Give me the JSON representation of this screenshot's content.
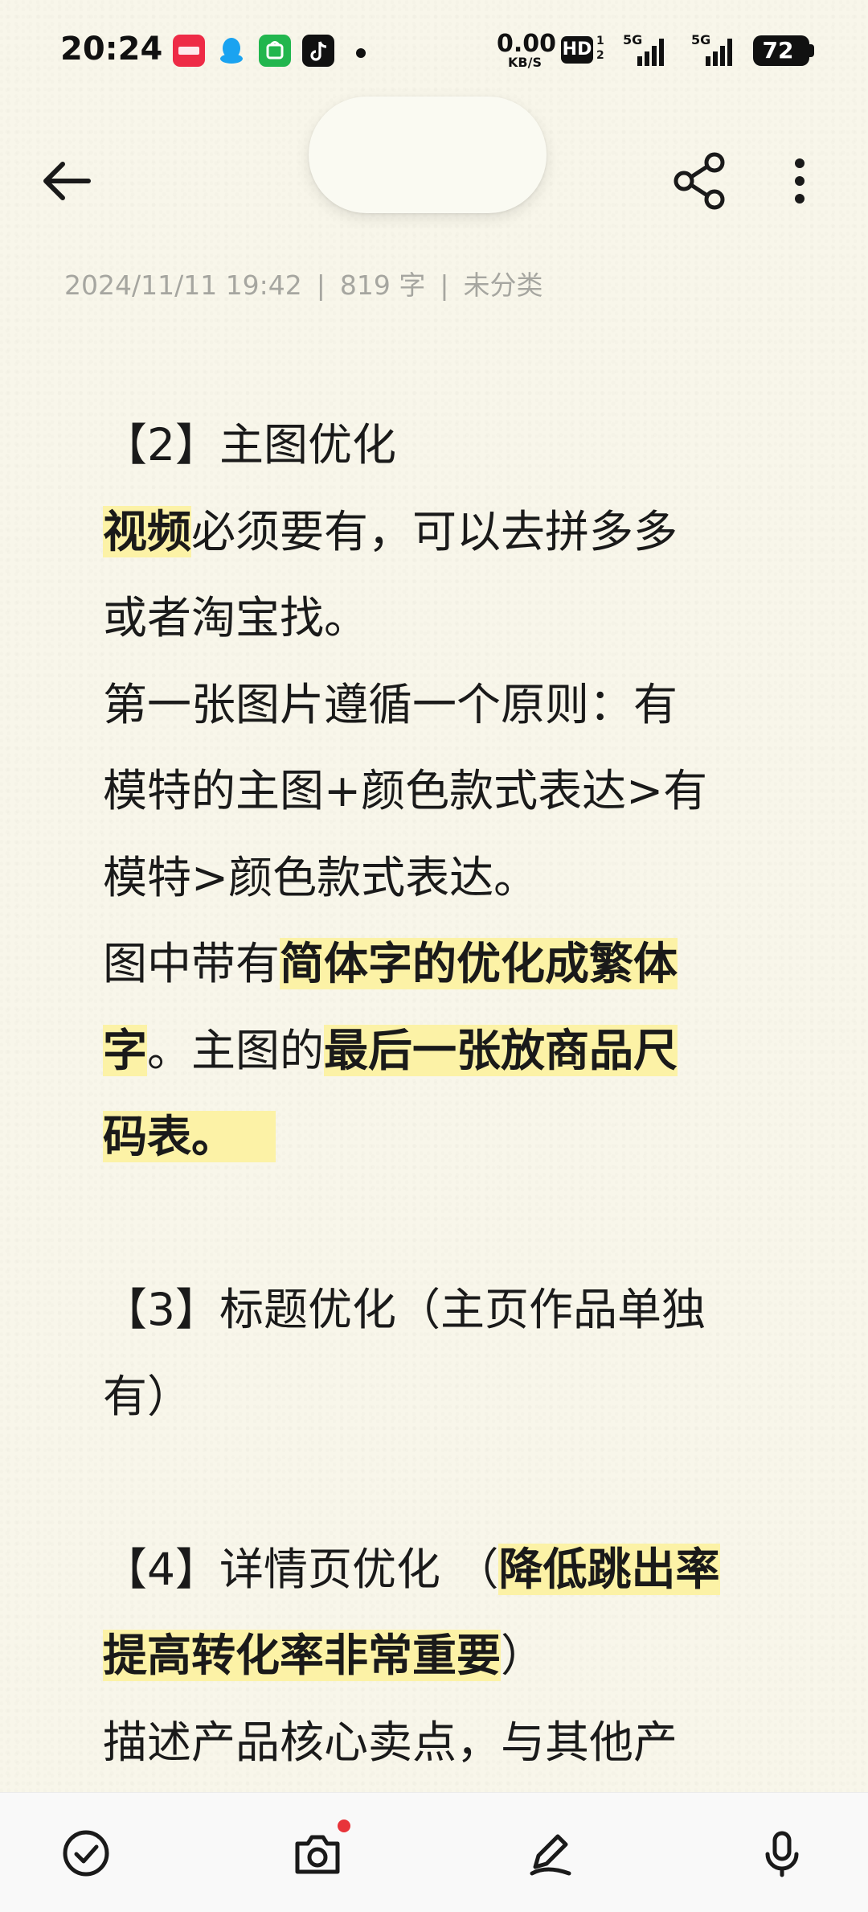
{
  "status_bar": {
    "time": "20:24",
    "net_speed_value": "0.00",
    "net_speed_unit": "KB/S",
    "hd": "HD",
    "hd_sub_top": "1",
    "hd_sub_bottom": "2",
    "sim1_label": "5G",
    "sim2_label": "5G",
    "battery": "72",
    "app_icons": [
      "xiaohongshu-icon",
      "qq-icon",
      "app-store-icon",
      "tiktok-icon"
    ]
  },
  "toolbar": {
    "back_icon": "arrow-left-icon",
    "share_icon": "share-icon",
    "more_icon": "more-vertical-icon"
  },
  "meta": {
    "datetime": "2024/11/11 19:42",
    "word_count": "819 字",
    "category": "未分类"
  },
  "note": {
    "s2_heading": "【2】主图优化",
    "s2_p1_hl": "视频",
    "s2_p1_rest": "必须要有，可以去拼多多",
    "s2_p1_line2": "或者淘宝找。",
    "s2_p2_line1": "第一张图片遵循一个原则：有",
    "s2_p2_line2": "模特的主图+颜色款式表达>有",
    "s2_p2_line3": "模特>颜色款式表达。",
    "s2_p3_a": "图中带有",
    "s2_p3_hl1": "简体字的优化成繁体",
    "s2_p3_hl1b": "字",
    "s2_p3_b": "。主图的",
    "s2_p3_hl2": "最后一张放商品尺",
    "s2_p3_hl2b": "码表。",
    "s3_heading_l1": "【3】标题优化（主页作品单独",
    "s3_heading_l2": "有）",
    "s4_heading_a": "【4】详情页优化 （",
    "s4_heading_hl1": "降低跳出率",
    "s4_heading_hl2": "提高转化率非常重要",
    "s4_heading_b": "）",
    "s4_p1_line1": "描述产品核心卖点，与其他产"
  },
  "bottom_bar": {
    "items": [
      "checklist-icon",
      "camera-icon",
      "pen-icon",
      "microphone-icon"
    ]
  },
  "colors": {
    "background": "#f8f6ea",
    "highlight": "#fcf2a6",
    "meta_text": "#a6a6a0",
    "badge_red": "#e8343a"
  }
}
